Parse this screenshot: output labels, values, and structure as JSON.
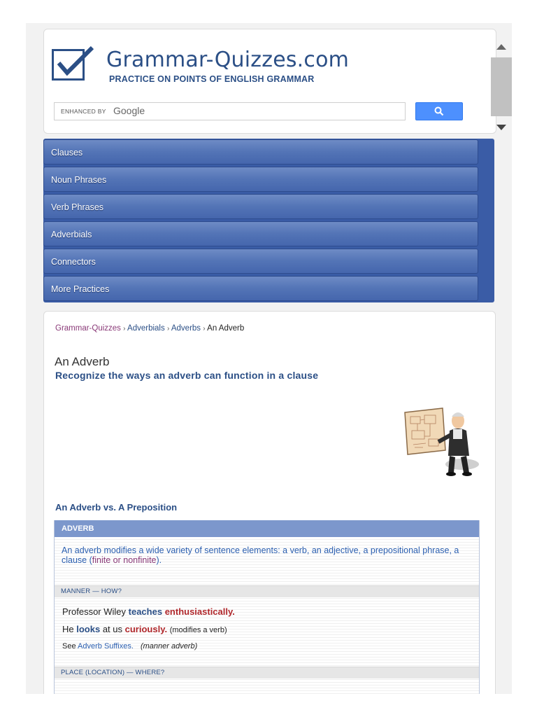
{
  "site": {
    "title": "Grammar-Quizzes.com",
    "tagline": "PRACTICE ON POINTS OF ENGLISH GRAMMAR"
  },
  "search": {
    "enhanced_label": "ENHANCED BY",
    "brand": "Google"
  },
  "nav": {
    "items": [
      {
        "label": "Clauses"
      },
      {
        "label": "Noun Phrases"
      },
      {
        "label": "Verb Phrases"
      },
      {
        "label": "Adverbials"
      },
      {
        "label": "Connectors"
      },
      {
        "label": "More Practices"
      }
    ]
  },
  "breadcrumb": {
    "items": [
      "Grammar-Quizzes",
      "Adverbials",
      "Adverbs"
    ],
    "current": "An Adverb",
    "separator": "›"
  },
  "page": {
    "title": "An Adverb",
    "subtitle": "Recognize the ways an adverb can function in a clause"
  },
  "section": {
    "heading": "An Adverb vs. A Preposition",
    "table_header": "ADVERB",
    "description_start": "An adverb modifies a wide variety of sentence elements: a verb, an adjective, a prepositional phrase, a clause (",
    "description_link": "finite or nonfinite",
    "description_end": ").",
    "manner_label": "MANNER — HOW?",
    "ex1": {
      "subject": "Professor Wiley ",
      "verb": "teaches",
      "adverb": "enthusiastically."
    },
    "ex2": {
      "subject": "He ",
      "verb": "looks",
      "mid": " at us ",
      "adverb": "curiously.",
      "note": "(modifies a verb)"
    },
    "ex3": {
      "see": "See ",
      "link": "Adverb Suffixes.",
      "note": "(manner adverb)"
    },
    "place_label": "PLACE (LOCATION) — WHERE?"
  },
  "colors": {
    "brand_blue": "#2b4f86",
    "nav_blue": "#3a5ca6",
    "table_header": "#7c97cc",
    "adverb_red": "#b0282c",
    "search_button": "#4d90fe"
  },
  "icons": {
    "logo": "checkbox-check-icon",
    "search": "search-icon",
    "illustration": "professor-with-diagram-icon"
  }
}
